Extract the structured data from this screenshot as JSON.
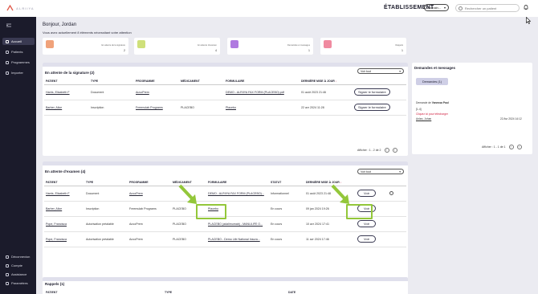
{
  "app": {
    "logo_text": "ALRIIYA"
  },
  "header": {
    "etablissement_label": "ÉTABLISSEMENT",
    "etablissement_value": "Domain...",
    "search_placeholder": "Rechercher un patient"
  },
  "sidebar": {
    "items": [
      {
        "label": "Accueil",
        "icon": "home-icon"
      },
      {
        "label": "Patients",
        "icon": "users-icon"
      },
      {
        "label": "Programmes",
        "icon": "programs-icon"
      },
      {
        "label": "Importer",
        "icon": "import-icon"
      }
    ],
    "bottom": [
      {
        "label": "Déconnexion",
        "icon": "logout-icon"
      },
      {
        "label": "Compte",
        "icon": "account-icon"
      },
      {
        "label": "Assistance",
        "icon": "help-icon"
      },
      {
        "label": "Paramètres",
        "icon": "settings-icon"
      }
    ]
  },
  "greeting": {
    "title": "Bonjour, Jordan",
    "subtitle": "Vous avez actuellement 8 éléments nécessitant votre attention"
  },
  "stats": [
    {
      "label": "En attente de la signature",
      "value": "2",
      "color": "#f0a27a"
    },
    {
      "label": "En attente d'examen",
      "value": "4",
      "color": "#cfe07a"
    },
    {
      "label": "Demandes et messages",
      "value": "1",
      "color": "#b07ae0"
    },
    {
      "label": "Rappels",
      "value": "1",
      "color": "#f08aa0"
    }
  ],
  "signature": {
    "title": "En attente de la signature (2)",
    "filter": "Voir tout",
    "columns": [
      "PATIENT",
      "TYPE",
      "PROGRAMME",
      "MÉDICAMENT",
      "FORMULAIRE",
      "DERNIÈRE MISE À JOUR"
    ],
    "rows": [
      {
        "patient": "Harris, Elizabeth F",
        "type": "Document",
        "programme": "AuvoPrem",
        "medicament": "",
        "formulaire": "DEMO - ALRIIYA FAX FORM (PLACEBO).pdf",
        "date": "01 août 2023 21:46",
        "action": "Signer le formulaire"
      },
      {
        "patient": "Barber, Alice",
        "type": "Inscription",
        "programme": "Freemulab Programs",
        "medicament": "PLACEBO",
        "formulaire": "Placebo",
        "date": "22 avr 2024 11:28",
        "action": "Signer le formulaire"
      }
    ],
    "pager": "Afficher : 1 - 2 de 2"
  },
  "exam": {
    "title": "En attente d'examen (4)",
    "filter": "Voir tout",
    "columns": [
      "PATIENT",
      "TYPE",
      "PROGRAMME",
      "MÉDICAMENT",
      "FORMULAIRE",
      "STATUT",
      "DERNIÈRE MISE À JOUR"
    ],
    "rows": [
      {
        "patient": "Harris, Elizabeth F",
        "type": "Document",
        "programme": "AuvoPrem",
        "medicament": "",
        "formulaire": "DEMO - ALRIIYA FAX FORM (PLACEBO)...",
        "statut": "Informationnel",
        "date": "01 août 2023 21:48",
        "action": "Voir"
      },
      {
        "patient": "Barber, Alice",
        "type": "Inscription",
        "programme": "Freemulab Programs",
        "medicament": "PLACEBO",
        "formulaire": "Placebo",
        "statut": "En cours",
        "date": "09 jan 2024 19:26",
        "action": "Voir"
      },
      {
        "patient": "Pope, Francisca",
        "type": "Autorisation préalable",
        "programme": "AuvoPrem",
        "medicament": "PLACEBO",
        "formulaire": "PLACEBO (adalimumab) - MANULIFE O...",
        "statut": "En cours",
        "date": "10 avr 2024 17:41",
        "action": "Voir"
      },
      {
        "patient": "Pope, Francisca",
        "type": "Autorisation préalable",
        "programme": "AuvoPrem",
        "medicament": "PLACEBO",
        "formulaire": "PLACEBO - Demo Life National Insura...",
        "statut": "En cours",
        "date": "11 avr 2024 17:46",
        "action": "Voir"
      }
    ],
    "pager": "Afficher : 1 - 4 de 4"
  },
  "reminders": {
    "title": "Rappels (1)",
    "columns": [
      "PATIENT",
      "TYPE",
      "DATE"
    ]
  },
  "requests": {
    "title": "Demandes et messages",
    "tab": "Demandes (1)",
    "from": "Demande de Vanessa Paul",
    "ref": "[1-4]",
    "link_text": "Cliquez ici pour télécharger",
    "name": "Anlan, Johan",
    "date": "22 Avr 2024 14:12",
    "pager": "Afficher : 1 - 1 de 1"
  }
}
